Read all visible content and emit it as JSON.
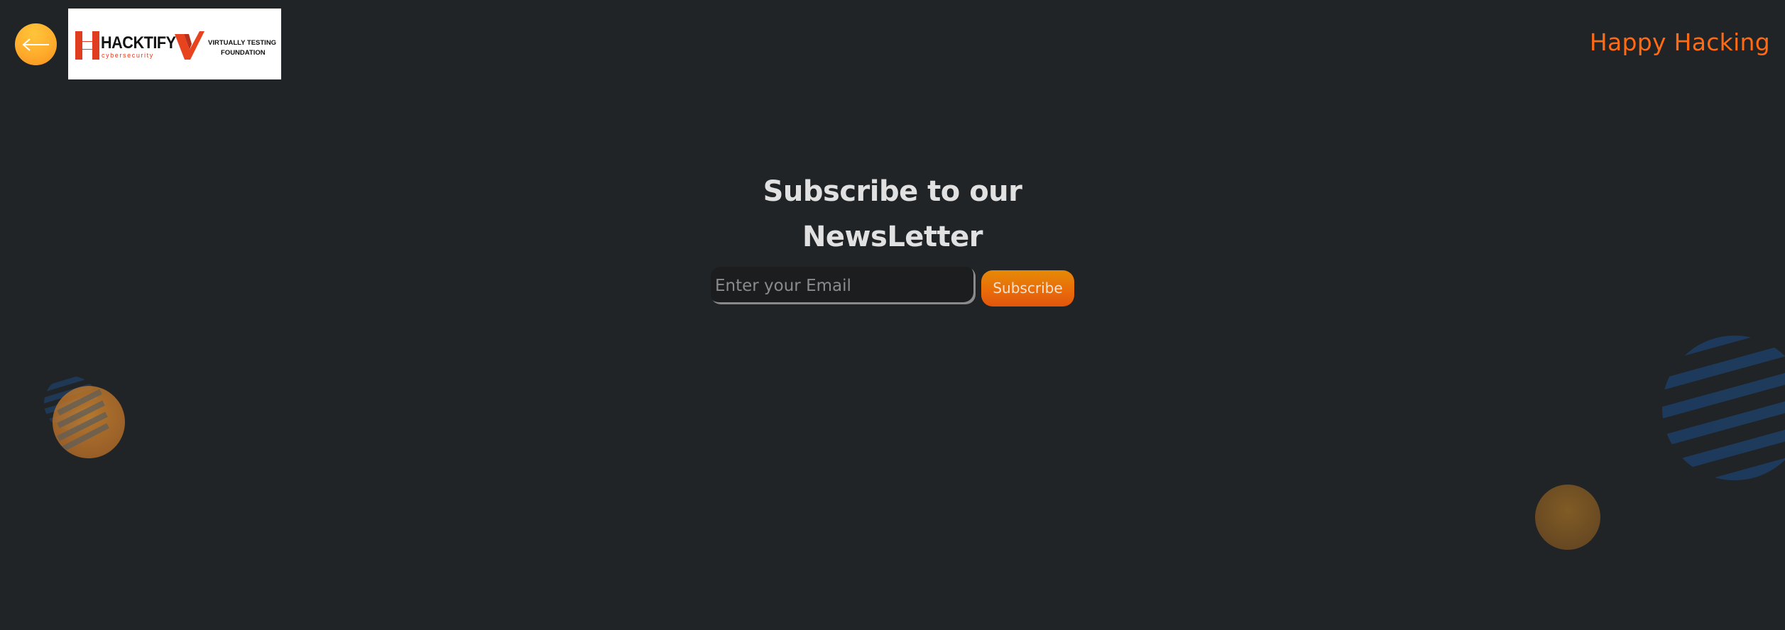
{
  "header": {
    "back_button": {
      "icon": "arrow-left-icon"
    },
    "logos": {
      "hacktify": {
        "name": "HACKTIFY",
        "tagline": "cybersecurity",
        "color": "#e03c20"
      },
      "vtf": {
        "line1": "VIRTUALLY TESTING",
        "line2": "FOUNDATION",
        "color": "#e8431f"
      }
    },
    "tagline": "Happy Hacking"
  },
  "newsletter": {
    "title": "Subscribe to our NewsLetter",
    "email_placeholder": "Enter your Email",
    "email_value": "",
    "subscribe_label": "Subscribe"
  },
  "colors": {
    "background": "#212426",
    "accent_orange": "#ff6a13",
    "button_gradient_start": "#e68a06",
    "button_gradient_end": "#e2560d",
    "title_text": "#e1e1e1",
    "stripe_blue": "#1e3d5f"
  }
}
